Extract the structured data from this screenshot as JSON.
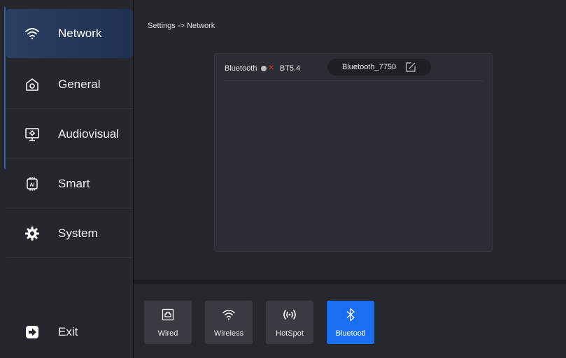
{
  "sidebar": {
    "items": [
      {
        "label": "Network",
        "icon": "wifi-icon",
        "active": true
      },
      {
        "label": "General",
        "icon": "general-icon"
      },
      {
        "label": "Audiovisual",
        "icon": "monitor-icon"
      },
      {
        "label": "Smart",
        "icon": "ai-chip-icon"
      },
      {
        "label": "System",
        "icon": "gear-icon"
      }
    ],
    "exit_label": "Exit"
  },
  "header": {
    "breadcrumb": "Settings -> Network"
  },
  "bluetooth": {
    "label": "Bluetooth",
    "enabled": false,
    "version": "BT5.4",
    "device_name": "Bluetooth_7750"
  },
  "tabs": [
    {
      "label": "Wired",
      "icon": "ethernet-icon"
    },
    {
      "label": "Wireless",
      "icon": "wifi-icon"
    },
    {
      "label": "HotSpot",
      "icon": "hotspot-icon"
    },
    {
      "label": "Bluetootl",
      "icon": "bluetooth-icon",
      "active": true
    }
  ],
  "colors": {
    "accent": "#1a6ff0",
    "active_nav": "#2b3f63",
    "toggle_off_x": "#e0312f"
  }
}
